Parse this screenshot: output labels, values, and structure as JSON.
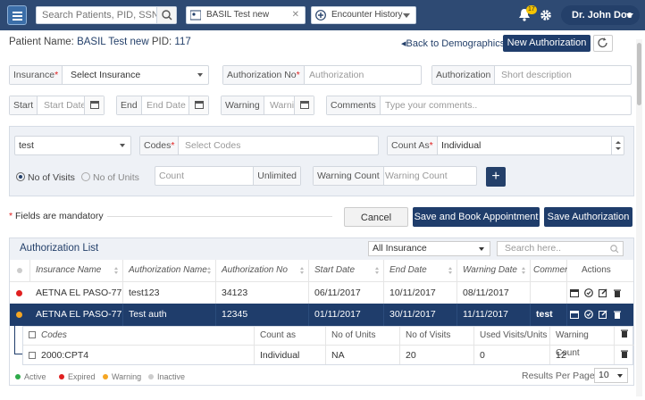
{
  "topbar": {
    "search_placeholder": "Search Patients, PID, SSN",
    "tab_patient_label": "BASIL Test new",
    "tab_encounter_label": "Encounter History",
    "notification_count": "17",
    "user_name": "Dr. John Doe"
  },
  "patient": {
    "name_label": "Patient Name:",
    "name": "BASIL Test new",
    "pid_label": "PID:",
    "pid": "117"
  },
  "actions": {
    "back_label": "Back to Demographics",
    "new_auth_label": "New Authorization"
  },
  "form": {
    "insurance_label": "Insurance",
    "insurance_value": "Select Insurance",
    "auth_no_label": "Authorization No",
    "auth_no_placeholder": "Authorization",
    "authorization_label": "Authorization",
    "authorization_placeholder": "Short description",
    "start_label": "Start",
    "start_placeholder": "Start Date",
    "end_label": "End",
    "end_placeholder": "End Date",
    "warning_label": "Warning",
    "warning_placeholder": "Warning",
    "comments_label": "Comments",
    "comments_placeholder": "Type your comments..",
    "type_value": "test",
    "codes_label": "Codes",
    "codes_placeholder": "Select Codes",
    "count_as_label": "Count As",
    "count_as_value": "Individual",
    "radio_visits": "No of Visits",
    "radio_units": "No of Units",
    "count_placeholder": "Count",
    "unlimited_label": "Unlimited",
    "warning_count_label": "Warning Count",
    "warning_count_placeholder": "Warning Count",
    "required_mark": "*",
    "mandatory_note": "Fields are mandatory",
    "cancel_label": "Cancel",
    "save_book_label": "Save and Book Appointment",
    "save_label": "Save Authorization"
  },
  "list": {
    "title": "Authorization List",
    "filter_value": "All Insurance",
    "search_placeholder": "Search here..",
    "columns": [
      "Insurance Name",
      "Authorization Name",
      "Authorization No",
      "Start Date",
      "End Date",
      "Warning Date",
      "Comments",
      "Actions"
    ],
    "rows": [
      {
        "status": "Expired",
        "insurance": "AETNA EL PASO-77",
        "auth_name": "test123",
        "auth_no": "34123",
        "start": "06/11/2017",
        "end": "10/11/2017",
        "warning": "08/11/2017",
        "comments": ""
      },
      {
        "status": "Warning",
        "insurance": "AETNA EL PASO-77",
        "auth_name": "Test auth",
        "auth_no": "12345",
        "start": "01/11/2017",
        "end": "30/11/2017",
        "warning": "11/11/2017",
        "comments": "test"
      }
    ],
    "sub_columns": [
      "Codes",
      "Count as",
      "No of Units",
      "No of Visits",
      "Used Visits/Units",
      "Warning Count"
    ],
    "sub_row": {
      "code": "2000:CPT4",
      "count_as": "Individual",
      "units": "NA",
      "visits": "20",
      "used": "0",
      "warning_count": "12"
    },
    "legend": [
      {
        "label": "Active",
        "color": "#2eaa4a"
      },
      {
        "label": "Expired",
        "color": "#e02020"
      },
      {
        "label": "Warning",
        "color": "#f5a623"
      },
      {
        "label": "Inactive",
        "color": "#cccccc"
      }
    ],
    "results_per_page_label": "Results Per Page",
    "results_per_page_value": "10"
  },
  "colors": {
    "primary": "#1f3d6b",
    "topbar": "#2e4a73",
    "expired": "#e02020",
    "warning": "#f5a623"
  }
}
